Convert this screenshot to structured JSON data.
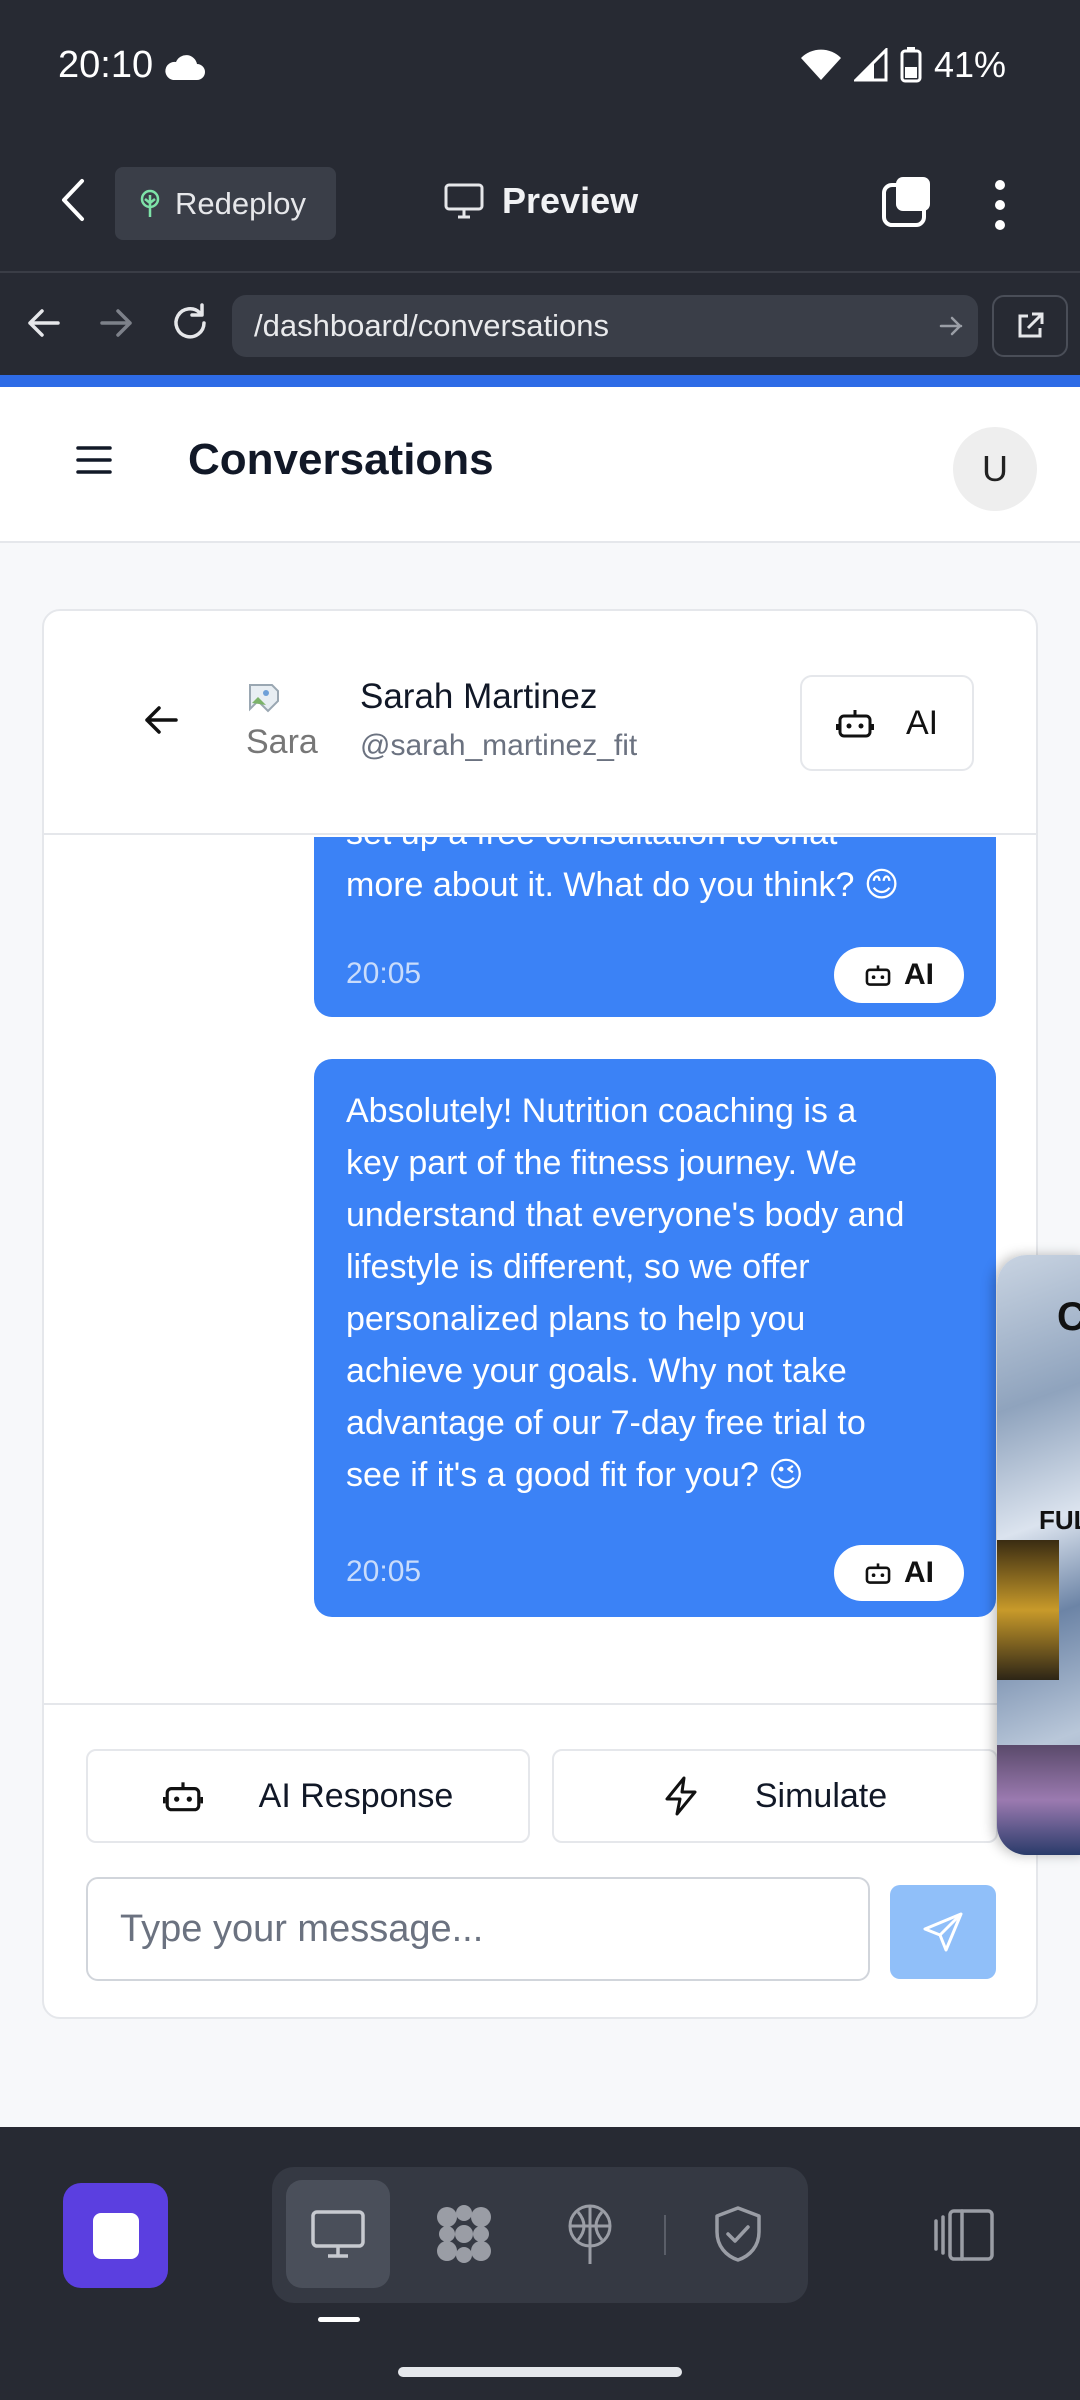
{
  "status_bar": {
    "time": "20:10",
    "battery": "41%"
  },
  "app_toolbar": {
    "redeploy_label": "Redeploy",
    "preview_label": "Preview"
  },
  "browser": {
    "url": "/dashboard/conversations"
  },
  "header": {
    "title": "Conversations",
    "user_initial": "U"
  },
  "conversation": {
    "contact_name": "Sarah Martinez",
    "contact_handle": "@sarah_martinez_fit",
    "avatar_alt": "Sara",
    "ai_toggle_label": "AI",
    "messages": [
      {
        "text": "set up a free consultation to chat\nmore about it. What do you think? 😊",
        "time": "20:05",
        "badge": "AI"
      },
      {
        "text": "Absolutely! Nutrition coaching is a\nkey part of the fitness journey. We\nunderstand that everyone's body and\nlifestyle is different, so we offer\npersonalized plans to help you\nachieve your goals. Why not take\nadvantage of our 7-day free trial to\nsee if it's a good fit for you? 😉",
        "time": "20:05",
        "badge": "AI"
      }
    ]
  },
  "footer": {
    "ai_response_label": "AI Response",
    "simulate_label": "Simulate",
    "input_placeholder": "Type your message..."
  },
  "floating_media": {
    "text": "FUL"
  },
  "colors": {
    "accent": "#3b82f6",
    "send_disabled": "#90bff9",
    "app_icon": "#5b3fe0"
  }
}
